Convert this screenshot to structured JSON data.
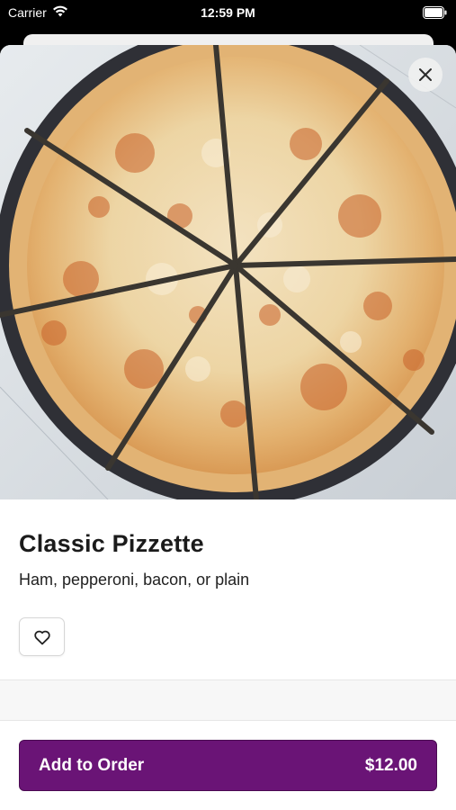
{
  "status_bar": {
    "carrier": "Carrier",
    "time": "12:59 PM",
    "icons": [
      "wifi-icon",
      "battery-icon"
    ]
  },
  "item": {
    "name": "Classic Pizzette",
    "description": "Ham, pepperoni, bacon, or plain",
    "image_alt": "Sliced cheese pizza"
  },
  "actions": {
    "close_icon": "close-icon",
    "favorite_icon": "heart-icon",
    "add_label": "Add to Order",
    "price": "$12.00"
  },
  "colors": {
    "accent": "#6a1476",
    "status_bar_bg": "#000000",
    "sheet_bg": "#ffffff"
  }
}
